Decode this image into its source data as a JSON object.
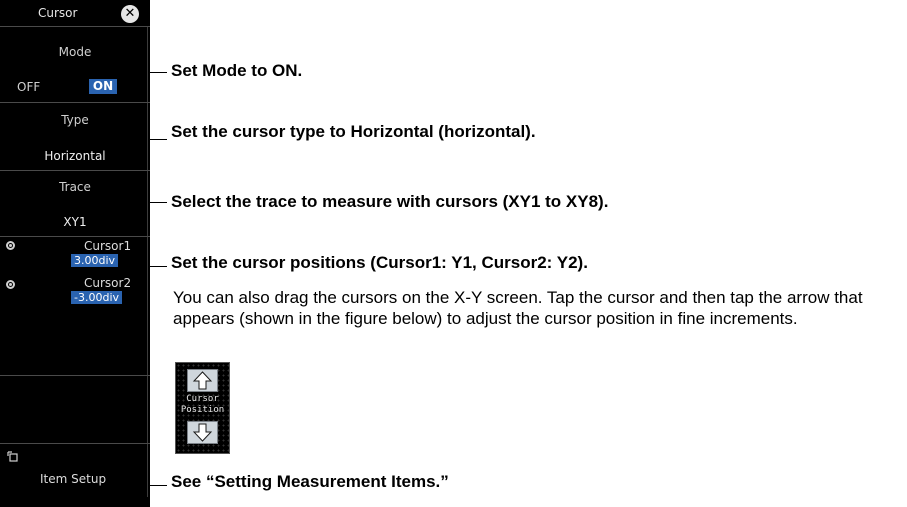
{
  "panel": {
    "title": "Cursor",
    "close_glyph": "✕",
    "mode": {
      "label": "Mode",
      "off": "OFF",
      "on": "ON"
    },
    "type": {
      "label": "Type",
      "value": "Horizontal"
    },
    "trace": {
      "label": "Trace",
      "value": "XY1"
    },
    "cursor1": {
      "name": "Cursor1",
      "value": "3.00div"
    },
    "cursor2": {
      "name": "Cursor2",
      "value": "-3.00div"
    },
    "item_setup": "Item Setup"
  },
  "callouts": {
    "mode": "Set Mode to ON.",
    "type": "Set the cursor type to Horizontal (horizontal).",
    "trace": "Select the trace to measure with cursors (XY1 to XY8).",
    "position": "Set the cursor positions (Cursor1: Y1, Cursor2: Y2).",
    "position_desc": "You can also drag the cursors on the X-Y screen. Tap the cursor and then tap the arrow that appears (shown in the figure below) to adjust the cursor position in fine increments.",
    "setup": "See “Setting Measurement Items.”"
  },
  "widget": {
    "line1": "Cursor",
    "line2": "Position"
  },
  "colors": {
    "panel_bg": "#000000",
    "highlight": "#2a63b0"
  }
}
